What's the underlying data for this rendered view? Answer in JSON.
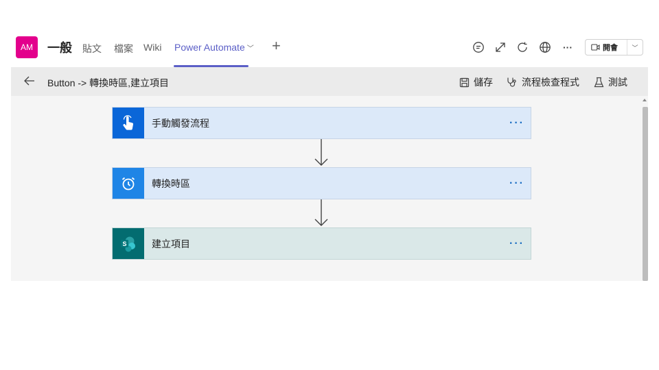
{
  "topbar": {
    "avatar": "AM",
    "channel": "一般",
    "tabs": [
      {
        "label": "貼文"
      },
      {
        "label": "檔案"
      },
      {
        "label": "Wiki"
      },
      {
        "label": "Power Automate"
      }
    ],
    "add_tab": "+",
    "icons": [
      "chat-icon",
      "expand-icon",
      "refresh-icon",
      "globe-icon",
      "more-icon"
    ],
    "more_label": "···",
    "meet_label": "開會"
  },
  "subbar": {
    "flow_title": "Button -> 轉換時區,建立項目",
    "save_label": "儲存",
    "checker_label": "流程檢查程式",
    "test_label": "測試"
  },
  "flow": {
    "steps": [
      {
        "label": "手動觸發流程",
        "icon": "touch-icon",
        "color": "#0a66d8",
        "bg": "#dce9f9"
      },
      {
        "label": "轉換時區",
        "icon": "clock-icon",
        "color": "#1f85e6",
        "bg": "#dce9f9"
      },
      {
        "label": "建立項目",
        "icon": "sharepoint-icon",
        "color": "#036c70",
        "bg": "#dae8e8"
      }
    ],
    "more": "···"
  },
  "colors": {
    "accent": "#5b5fc7",
    "avatar": "#e3008c"
  }
}
